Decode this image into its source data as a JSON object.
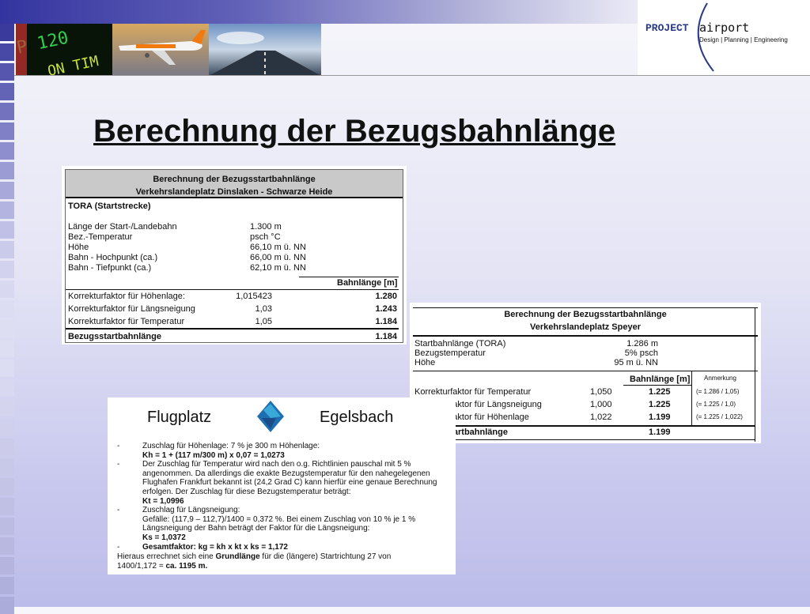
{
  "header": {
    "logo_project": "PROJECT",
    "logo_airport": "airport",
    "logo_tagline": "Design | Planning | Engineering"
  },
  "slide": {
    "title": "Berechnung der Bezugsbahnlänge"
  },
  "dinslaken": {
    "title1": "Berechnung der Bezugsstartbahnlänge",
    "title2": "Verkehrslandeplatz Dinslaken - Schwarze Heide",
    "section": "TORA (Startstrecke)",
    "params": [
      {
        "label": "Länge der Start-/Landebahn",
        "value": "1.300 m"
      },
      {
        "label": "Bez.-Temperatur",
        "value": "psch °C"
      },
      {
        "label": "Höhe",
        "value": "66,10 m ü. NN"
      },
      {
        "label": "Bahn - Hochpunkt (ca.)",
        "value": "66,00 m ü. NN"
      },
      {
        "label": "Bahn - Tiefpunkt (ca.)",
        "value": "62,10 m ü. NN"
      }
    ],
    "col_header": "Bahnlänge [m]",
    "factors": [
      {
        "label": "Korrekturfaktor für Höhenlage:",
        "factor": "1,015423",
        "length": "1.280"
      },
      {
        "label": "Korrekturfaktor für Längsneigung",
        "factor": "1,03",
        "length": "1.243"
      },
      {
        "label": "Korrekturfaktor für Temperatur",
        "factor": "1,05",
        "length": "1.184"
      }
    ],
    "total_label": "Bezugsstartbahnlänge",
    "total_value": "1.184"
  },
  "speyer": {
    "title1": "Berechnung der Bezugsstartbahnlänge",
    "title2": "Verkehrslandeplatz Speyer",
    "params": [
      {
        "label": "Startbahnlänge (TORA)",
        "value": "1.286 m"
      },
      {
        "label": "Bezugstemperatur",
        "value": "5% psch"
      },
      {
        "label": "Höhe",
        "value": "95 m ü. NN"
      }
    ],
    "col_header": "Bahnlänge [m]",
    "col_note": "Anmerkung",
    "factors": [
      {
        "label": "Korrekturfaktor für Temperatur",
        "factor": "1,050",
        "length": "1.225",
        "note": "(= 1.286 / 1,05)"
      },
      {
        "label": "Korrekturfaktor für Längsneigung",
        "factor": "1,000",
        "length": "1.225",
        "note": "(= 1.225 / 1,0)"
      },
      {
        "label": "Korrekturfaktor für Höhenlage",
        "factor": "1,022",
        "length": "1.199",
        "note": "(= 1.225 / 1,022)"
      }
    ],
    "total_label": "Bezugsstartbahnlänge",
    "total_value": "1.199"
  },
  "egelsbach": {
    "head_left": "Flugplatz",
    "head_right": "Egelsbach",
    "lines": [
      {
        "text": "Zuschlag für Höhenlage: 7 % je 300 m Höhenlage:",
        "dash": "-",
        "bold": false
      },
      {
        "text": "Kh = 1 + (117 m/300 m) x 0,07 = 1,0273",
        "dash": "",
        "bold": true
      },
      {
        "text": "Der Zuschlag für Temperatur wird nach den o.g. Richtlinien pauschal mit 5 %",
        "dash": "-",
        "bold": false
      },
      {
        "text": "angenommen. Da allerdings die exakte Bezugstemperatur für den nahegelegenen",
        "dash": "",
        "bold": false
      },
      {
        "text": "Flughafen Frankfurt bekannt ist (24,2 Grad C) kann hierfür eine genaue Berechnung",
        "dash": "",
        "bold": false
      },
      {
        "text": "erfolgen. Der Zuschlag für diese Bezugstemperatur beträgt:",
        "dash": "",
        "bold": false
      },
      {
        "text": "Kt = 1,0996",
        "dash": "",
        "bold": true
      },
      {
        "text": "Zuschlag für Längsneigung:",
        "dash": "-",
        "bold": false
      },
      {
        "text": "Gefälle: (117,9 – 112,7)/1400 = 0,372 %. Bei einem Zuschlag von 10 % je 1 %",
        "dash": "",
        "bold": false
      },
      {
        "text": "Längsneigung der Bahn beträgt der Faktor für die Längsneigung:",
        "dash": "",
        "bold": false
      },
      {
        "text": "Ks = 1,0372",
        "dash": "",
        "bold": true
      },
      {
        "text": "Gesamtfaktor: kg = kh x kt x ks = 1,172",
        "dash": "-",
        "bold": true
      }
    ],
    "closing1_pre": "Hieraus errechnet sich eine ",
    "closing1_bold": "Grundlänge",
    "closing1_post": " für die (längere) Startrichtung 27 von",
    "closing2_pre": "1400/1,172 = ",
    "closing2_bold": "ca. 1195 m."
  },
  "colors": {
    "left_strip": [
      "#3a3a9c",
      "#4848a6",
      "#5656ae",
      "#6464b6",
      "#7272be",
      "#8080c6",
      "#8e8ece",
      "#9c9cd4",
      "#a8a8da",
      "#b4b4e0",
      "#c0c0e6",
      "#cacaeb",
      "#d2d2ee",
      "#d8d8f0",
      "#dcdcf2",
      "#dedef2",
      "#dedef2",
      "#dcdcf2",
      "#d8d8f0",
      "#d4d4ee",
      "#d0d0ec",
      "#ccccea",
      "#c8c8e8",
      "#c4c4e6",
      "#c0c0e4",
      "#bcbce2",
      "#b8b8e0",
      "#b4b4de",
      "#b0b0dc",
      "#acacda"
    ]
  }
}
